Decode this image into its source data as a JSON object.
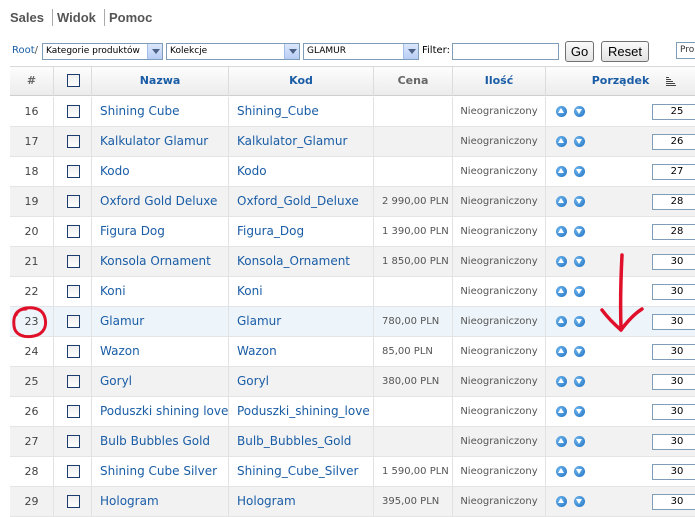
{
  "menu": [
    {
      "label": "Sales"
    },
    {
      "label": "Widok"
    },
    {
      "label": "Pomoc"
    }
  ],
  "toolbar": {
    "root_label": "Root",
    "root_sep": "/",
    "category_select": "Kategorie produktów",
    "collection_select": "Kolekcje",
    "collection_value": "GLAMUR",
    "filter_label": "Filter:",
    "filter_value": "",
    "go_label": "Go",
    "reset_label": "Reset",
    "extra_select": "Pro"
  },
  "table": {
    "headers": {
      "id": "#",
      "name": "Nazwa",
      "code": "Kod",
      "price": "Cena",
      "qty": "Ilość",
      "order": "Porządek"
    },
    "rows": [
      {
        "id": "16",
        "name": "Shining Cube",
        "code": "Shining_Cube",
        "price": "",
        "qty": "Nieograniczony",
        "order": "25"
      },
      {
        "id": "17",
        "name": "Kalkulator Glamur",
        "code": "Kalkulator_Glamur",
        "price": "",
        "qty": "Nieograniczony",
        "order": "26"
      },
      {
        "id": "18",
        "name": "Kodo",
        "code": "Kodo",
        "price": "",
        "qty": "Nieograniczony",
        "order": "27"
      },
      {
        "id": "19",
        "name": "Oxford Gold Deluxe",
        "code": "Oxford_Gold_Deluxe",
        "price": "2 990,00 PLN",
        "qty": "Nieograniczony",
        "order": "28"
      },
      {
        "id": "20",
        "name": "Figura Dog",
        "code": "Figura_Dog",
        "price": "1 390,00 PLN",
        "qty": "Nieograniczony",
        "order": "28"
      },
      {
        "id": "21",
        "name": "Konsola Ornament",
        "code": "Konsola_Ornament",
        "price": "1 850,00 PLN",
        "qty": "Nieograniczony",
        "order": "30"
      },
      {
        "id": "22",
        "name": "Koni",
        "code": "Koni",
        "price": "",
        "qty": "Nieograniczony",
        "order": "30"
      },
      {
        "id": "23",
        "name": "Glamur",
        "code": "Glamur",
        "price": "780,00 PLN",
        "qty": "Nieograniczony",
        "order": "30"
      },
      {
        "id": "24",
        "name": "Wazon",
        "code": "Wazon",
        "price": "85,00 PLN",
        "qty": "Nieograniczony",
        "order": "30"
      },
      {
        "id": "25",
        "name": "Goryl",
        "code": "Goryl",
        "price": "380,00 PLN",
        "qty": "Nieograniczony",
        "order": "30"
      },
      {
        "id": "26",
        "name": "Poduszki shining love",
        "code": "Poduszki_shining_love",
        "price": "",
        "qty": "Nieograniczony",
        "order": "30"
      },
      {
        "id": "27",
        "name": "Bulb Bubbles Gold",
        "code": "Bulb_Bubbles_Gold",
        "price": "",
        "qty": "Nieograniczony",
        "order": "30"
      },
      {
        "id": "28",
        "name": "Shining Cube Silver",
        "code": "Shining_Cube_Silver",
        "price": "1 590,00 PLN",
        "qty": "Nieograniczony",
        "order": "30"
      },
      {
        "id": "29",
        "name": "Hologram",
        "code": "Hologram",
        "price": "395,00 PLN",
        "qty": "Nieograniczony",
        "order": "30"
      }
    ]
  },
  "colors": {
    "link": "#1a5da6",
    "annotation": "#e0102a",
    "highlight_row": "#eef5fa"
  },
  "icons": {
    "move_up": "arrow-up-circle-icon",
    "move_down": "arrow-down-circle-icon",
    "sort": "sort-lines-icon",
    "dropdown": "chevron-down-icon"
  }
}
